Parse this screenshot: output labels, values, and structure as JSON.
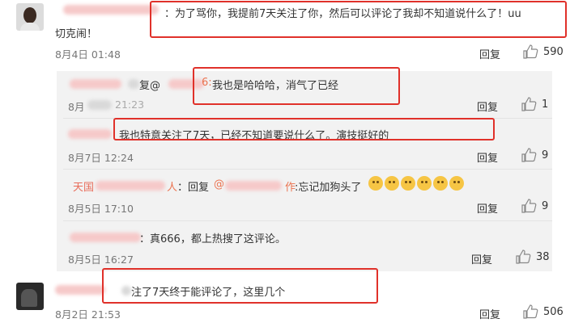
{
  "comments": [
    {
      "text_line1": "：为了骂你，我提前7天关注了你，然后可以评论了我却不知道说什么了！uu",
      "text_line2": "切克闹！",
      "time": "8月4日 01:48",
      "reply_label": "回复",
      "likes": "590"
    },
    {
      "prefix": "复@",
      "suffix": "6:",
      "text": "我也是哈哈哈，消气了已经",
      "time": "8月",
      "time_tail": "21:23",
      "reply_label": "回复",
      "likes": "1"
    },
    {
      "text": "我也特意关注了7天，已经不知道要说什么了。演技挺好的",
      "time": "8月7日 12:24",
      "reply_label": "回复",
      "likes": "9"
    },
    {
      "prefix_red": "天国",
      "name_tail": "人",
      "reply_word": "：回复",
      "at": "@",
      "mention_tail": "作",
      "text": ":忘记加狗头了",
      "time": "8月5日 17:10",
      "reply_label": "回复",
      "likes": "9"
    },
    {
      "text": "：真666，都上热搜了这评论。",
      "time": "8月5日 16:27",
      "reply_label": "回复",
      "likes": "38"
    },
    {
      "text": "注了7天终于能评论了，这里几个",
      "time": "8月2日 21:53",
      "reply_label": "回复",
      "likes": "506"
    }
  ]
}
